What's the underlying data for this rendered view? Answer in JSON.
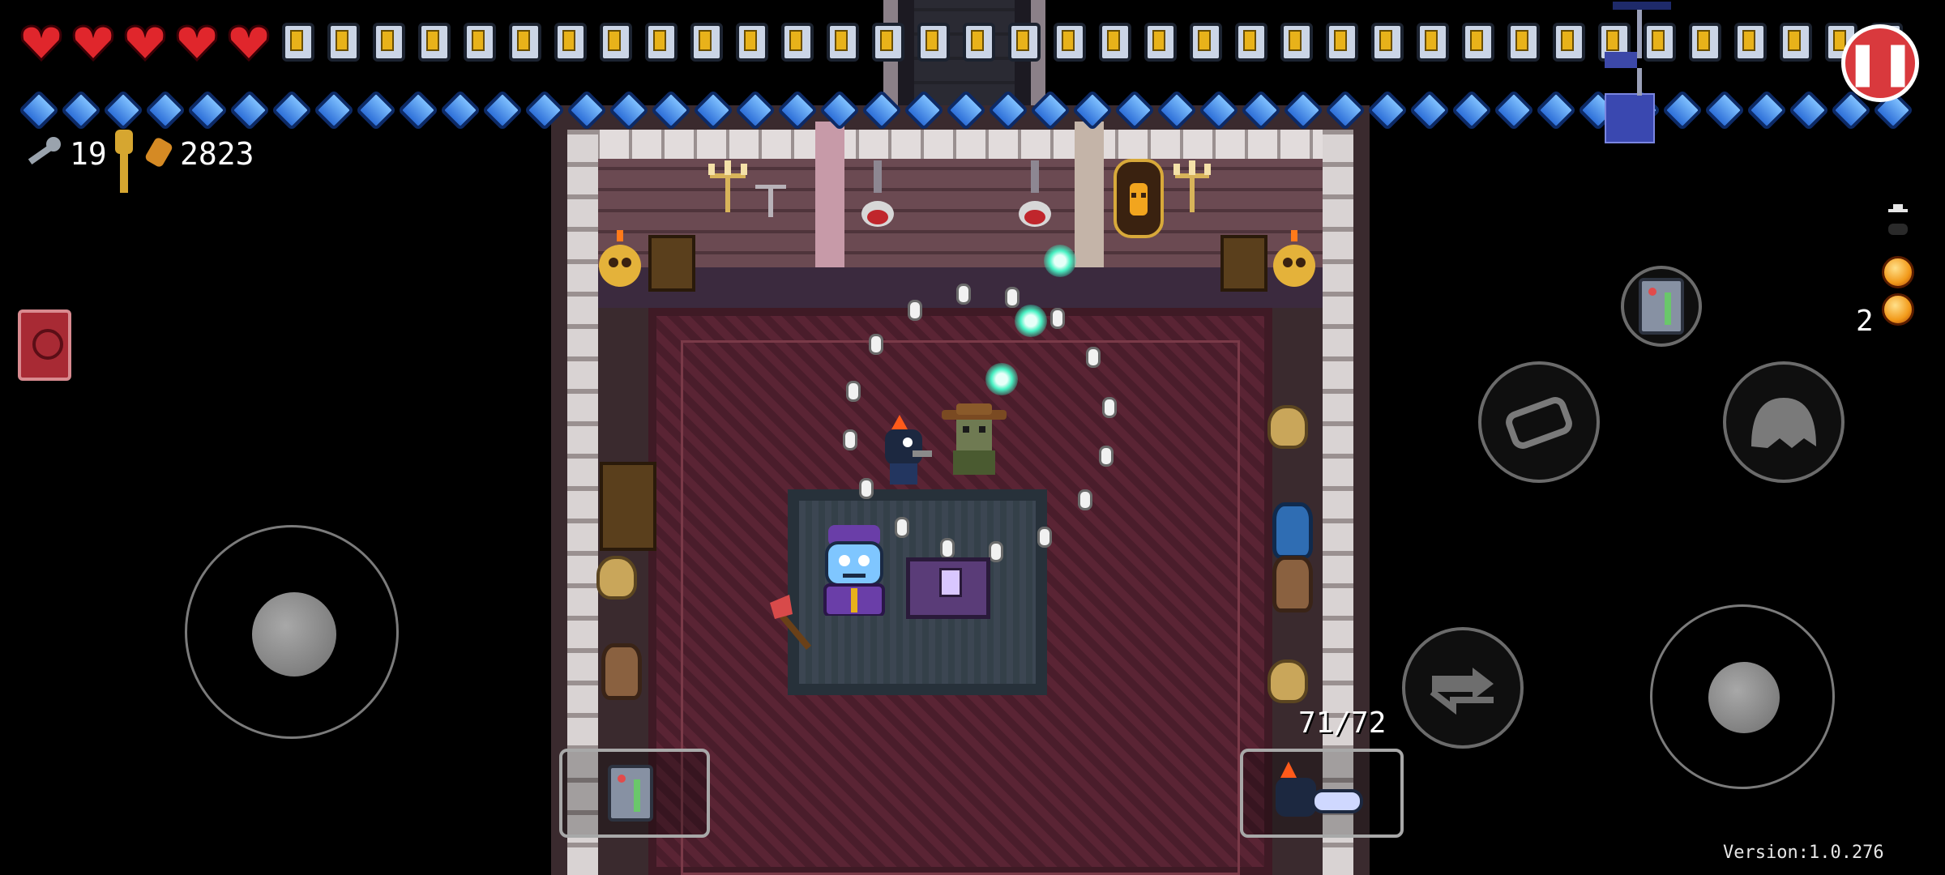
{
  "hud": {
    "hearts_full": 5,
    "armor_count": 36,
    "blanks_row_count": 45,
    "keys": "19",
    "currency": "2823",
    "ammo": "71/72",
    "blank_stock": "2",
    "pause_icon": "pause-icon",
    "pause_symbol": "❚❚",
    "version": "Version:1.0.276"
  },
  "colors": {
    "heart": "#e0262c",
    "armor_fill": "#e8b21a",
    "blank": "#4a9cff",
    "pause_button": "#d9393d",
    "orb": "#4af2c4"
  },
  "controls": {
    "move_stick": "movement-joystick",
    "aim_stick": "aim-joystick",
    "dodge_roll": "dodge-roll-button",
    "blank": "blank-button",
    "reload": "reload-swap-button",
    "active_item": "active-item-slot",
    "gun_slot": "gun-slot"
  }
}
